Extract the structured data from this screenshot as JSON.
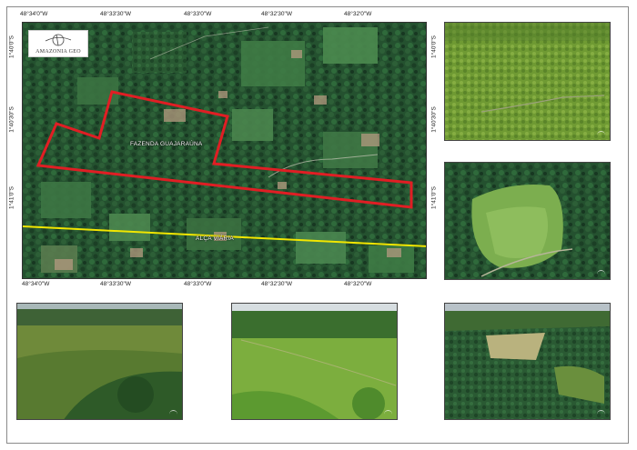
{
  "logo": {
    "text": "AMAZONIA GEO"
  },
  "map": {
    "labels": {
      "farm": "FAZENDA GUAJARAÚNA",
      "road": "ALÇA VIÁRIA"
    },
    "longitudes_top": [
      "48°34'0\"W",
      "48°33'30\"W",
      "48°33'0\"W",
      "48°32'30\"W",
      "48°32'0\"W"
    ],
    "longitudes_bottom": [
      "48°34'0\"W",
      "48°33'30\"W",
      "48°33'0\"W",
      "48°32'30\"W",
      "48°32'0\"W"
    ],
    "latitudes_left": [
      "1°40'0\"S",
      "1°40'30\"S",
      "1°41'0\"S"
    ],
    "latitudes_right": [
      "1°40'0\"S",
      "1°40'30\"S",
      "1°41'0\"S"
    ],
    "colors": {
      "boundary": "#e01e24",
      "road": "#f2e600",
      "forest": "#1f4a2c"
    }
  },
  "photos": [
    {
      "name": "photo-top-right",
      "description_icon": "aerial-field-icon"
    },
    {
      "name": "photo-middle-right",
      "description_icon": "aerial-clearing-icon"
    },
    {
      "name": "photo-bottom-left",
      "description_icon": "aerial-forest-icon"
    },
    {
      "name": "photo-bottom-center",
      "description_icon": "aerial-field-icon"
    },
    {
      "name": "photo-bottom-right",
      "description_icon": "aerial-clearing-icon"
    }
  ]
}
